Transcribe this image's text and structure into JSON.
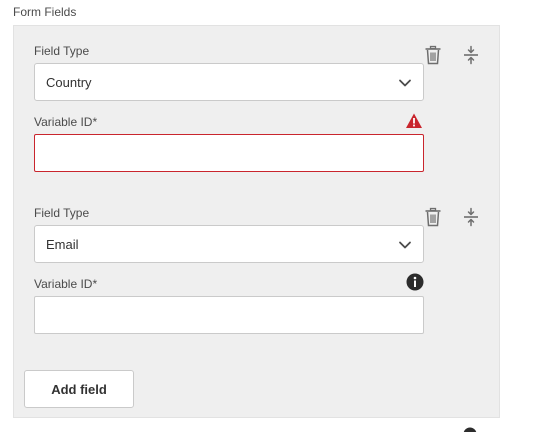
{
  "section": {
    "title": "Form Fields"
  },
  "fields": [
    {
      "type_label": "Field Type",
      "type_value": "Country",
      "variable_label": "Variable ID*",
      "variable_value": "",
      "status_icon": "alert-icon",
      "status_color": "#c9252d"
    },
    {
      "type_label": "Field Type",
      "type_value": "Email",
      "variable_label": "Variable ID*",
      "variable_value": "",
      "status_icon": "info-icon",
      "status_color": "#2c2c2c"
    }
  ],
  "actions": {
    "add_field_label": "Add field"
  },
  "icons": {
    "delete": "trash-icon",
    "reorder": "drag-handle-icon",
    "dropdown": "chevron-down-icon"
  },
  "colors": {
    "panel_bg": "#efefef",
    "error": "#c9252d",
    "text": "#4b4b4b"
  }
}
